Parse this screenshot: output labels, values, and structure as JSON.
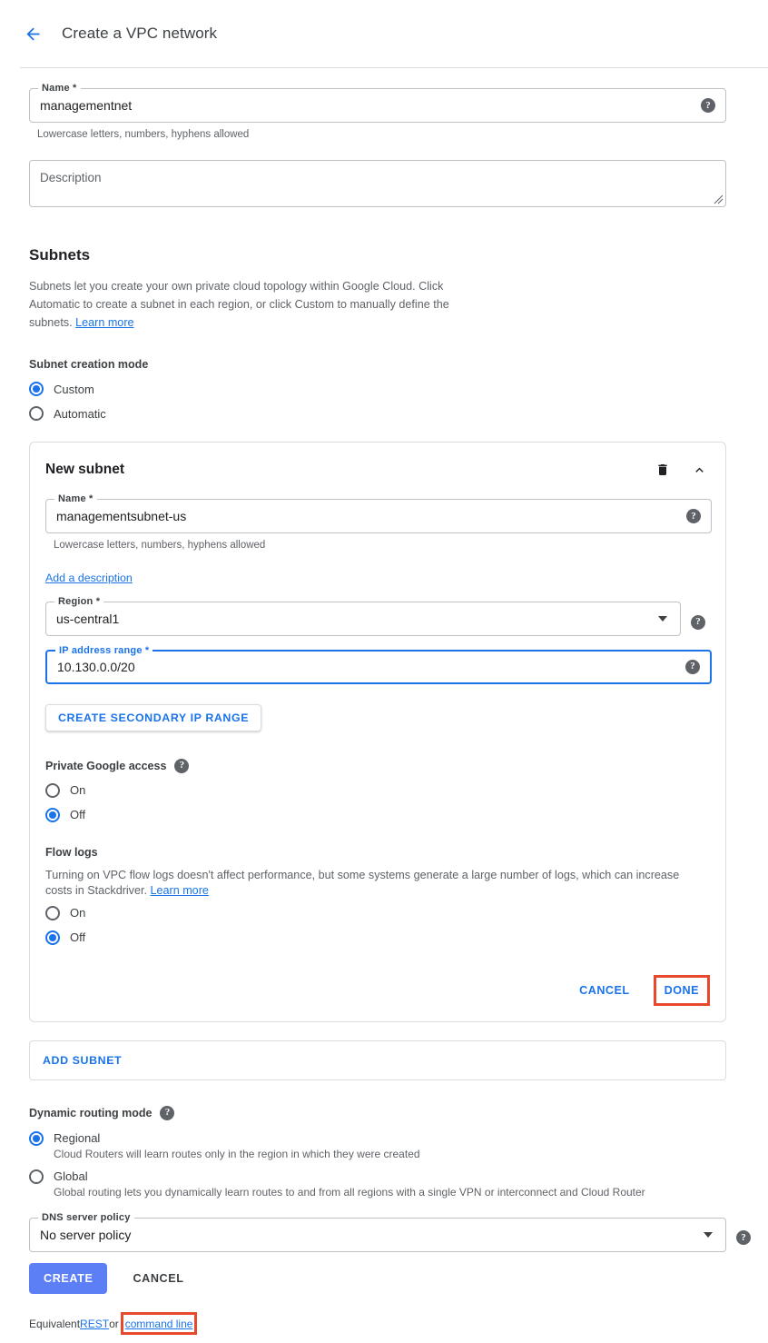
{
  "header": {
    "back_icon": "arrow-left-icon",
    "title": "Create a VPC network"
  },
  "network": {
    "name_field": {
      "label": "Name *",
      "value": "managementnet",
      "helper": "Lowercase letters, numbers, hyphens allowed",
      "help_icon": "help-icon"
    },
    "description_field": {
      "placeholder": "Description",
      "value": ""
    }
  },
  "subnets_section": {
    "heading": "Subnets",
    "description_part1": "Subnets let you create your own private cloud topology within Google Cloud. Click Automatic to create a subnet in each region, or click Custom to manually define the subnets. ",
    "learn_more": "Learn more",
    "creation_mode_label": "Subnet creation mode",
    "creation_mode_options": [
      {
        "label": "Custom",
        "selected": true
      },
      {
        "label": "Automatic",
        "selected": false
      }
    ]
  },
  "new_subnet": {
    "title": "New subnet",
    "delete_icon": "trash-icon",
    "collapse_icon": "chevron-up-icon",
    "name_field": {
      "label": "Name *",
      "value": "managementsubnet-us",
      "helper": "Lowercase letters, numbers, hyphens allowed"
    },
    "add_description_link": "Add a description",
    "region_field": {
      "label": "Region *",
      "value": "us-central1"
    },
    "ip_range_field": {
      "label": "IP address range *",
      "value": "10.130.0.0/20",
      "focused": true
    },
    "secondary_range_button": "CREATE SECONDARY IP RANGE",
    "private_google_access": {
      "label": "Private Google access",
      "options": [
        {
          "label": "On",
          "selected": false
        },
        {
          "label": "Off",
          "selected": true
        }
      ]
    },
    "flow_logs": {
      "label": "Flow logs",
      "description": "Turning on VPC flow logs doesn't affect performance, but some systems generate a large number of logs, which can increase costs in Stackdriver. ",
      "learn_more": "Learn more",
      "options": [
        {
          "label": "On",
          "selected": false
        },
        {
          "label": "Off",
          "selected": true
        }
      ]
    },
    "cancel_button": "CANCEL",
    "done_button": "DONE",
    "done_highlighted": true
  },
  "add_subnet_button": "ADD SUBNET",
  "dynamic_routing": {
    "label": "Dynamic routing mode",
    "options": [
      {
        "label": "Regional",
        "selected": true,
        "description": "Cloud Routers will learn routes only in the region in which they were created"
      },
      {
        "label": "Global",
        "selected": false,
        "description": "Global routing lets you dynamically learn routes to and from all regions with a single VPN or interconnect and Cloud Router"
      }
    ]
  },
  "dns_policy_field": {
    "label": "DNS server policy",
    "value": "No server policy"
  },
  "footer": {
    "create_button": "CREATE",
    "cancel_button": "CANCEL",
    "equivalent_prefix": "Equivalent ",
    "rest_link": "REST",
    "equivalent_or": " or ",
    "command_line_link": "command line",
    "command_line_highlighted": true
  },
  "colors": {
    "accent_blue": "#1a73e8",
    "create_blue": "#5c7ff5",
    "highlight_red": "#e8482b",
    "border_gray": "#dadce0",
    "text_secondary": "#5f6368"
  }
}
